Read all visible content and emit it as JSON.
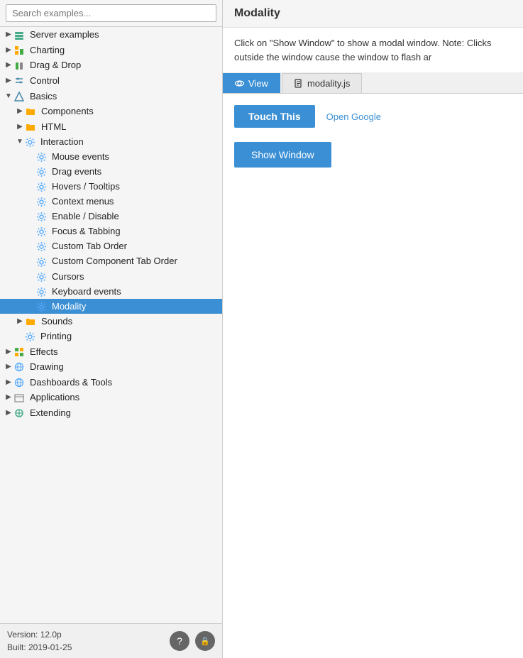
{
  "app": {
    "title": "Modality"
  },
  "search": {
    "placeholder": "Search examples..."
  },
  "tree": {
    "items": [
      {
        "id": "server-examples",
        "label": "Server examples",
        "indent": 0,
        "icon": "📋",
        "icon_class": "icon-server",
        "expandable": true,
        "expanded": false,
        "selected": false
      },
      {
        "id": "charting",
        "label": "Charting",
        "indent": 0,
        "icon": "📊",
        "icon_class": "icon-chart",
        "expandable": true,
        "expanded": false,
        "selected": false
      },
      {
        "id": "drag-drop",
        "label": "Drag & Drop",
        "indent": 0,
        "icon": "📦",
        "icon_class": "icon-drag",
        "expandable": true,
        "expanded": false,
        "selected": false
      },
      {
        "id": "control",
        "label": "Control",
        "indent": 0,
        "icon": "🎛",
        "icon_class": "icon-control",
        "expandable": true,
        "expanded": false,
        "selected": false
      },
      {
        "id": "basics",
        "label": "Basics",
        "indent": 0,
        "icon": "💡",
        "icon_class": "icon-basics",
        "expandable": true,
        "expanded": true,
        "selected": false
      },
      {
        "id": "components",
        "label": "Components",
        "indent": 1,
        "icon": "📁",
        "icon_class": "icon-folder",
        "expandable": true,
        "expanded": false,
        "selected": false
      },
      {
        "id": "html",
        "label": "HTML",
        "indent": 1,
        "icon": "📁",
        "icon_class": "icon-folder",
        "expandable": true,
        "expanded": false,
        "selected": false
      },
      {
        "id": "interaction",
        "label": "Interaction",
        "indent": 1,
        "icon": "⚙",
        "icon_class": "icon-gear",
        "expandable": true,
        "expanded": true,
        "selected": false
      },
      {
        "id": "mouse-events",
        "label": "Mouse events",
        "indent": 2,
        "icon": "⚙",
        "icon_class": "icon-gear",
        "expandable": false,
        "expanded": false,
        "selected": false
      },
      {
        "id": "drag-events",
        "label": "Drag events",
        "indent": 2,
        "icon": "⚙",
        "icon_class": "icon-gear",
        "expandable": false,
        "expanded": false,
        "selected": false
      },
      {
        "id": "hovers-tooltips",
        "label": "Hovers / Tooltips",
        "indent": 2,
        "icon": "⚙",
        "icon_class": "icon-gear",
        "expandable": false,
        "expanded": false,
        "selected": false
      },
      {
        "id": "context-menus",
        "label": "Context menus",
        "indent": 2,
        "icon": "⚙",
        "icon_class": "icon-gear",
        "expandable": false,
        "expanded": false,
        "selected": false
      },
      {
        "id": "enable-disable",
        "label": "Enable / Disable",
        "indent": 2,
        "icon": "⚙",
        "icon_class": "icon-gear",
        "expandable": false,
        "expanded": false,
        "selected": false
      },
      {
        "id": "focus-tabbing",
        "label": "Focus & Tabbing",
        "indent": 2,
        "icon": "⚙",
        "icon_class": "icon-gear",
        "expandable": false,
        "expanded": false,
        "selected": false
      },
      {
        "id": "custom-tab-order",
        "label": "Custom Tab Order",
        "indent": 2,
        "icon": "⚙",
        "icon_class": "icon-gear",
        "expandable": false,
        "expanded": false,
        "selected": false
      },
      {
        "id": "custom-component-tab-order",
        "label": "Custom Component Tab Order",
        "indent": 2,
        "icon": "⚙",
        "icon_class": "icon-gear",
        "expandable": false,
        "expanded": false,
        "selected": false
      },
      {
        "id": "cursors",
        "label": "Cursors",
        "indent": 2,
        "icon": "⚙",
        "icon_class": "icon-gear",
        "expandable": false,
        "expanded": false,
        "selected": false
      },
      {
        "id": "keyboard-events",
        "label": "Keyboard events",
        "indent": 2,
        "icon": "⚙",
        "icon_class": "icon-gear",
        "expandable": false,
        "expanded": false,
        "selected": false
      },
      {
        "id": "modality",
        "label": "Modality",
        "indent": 2,
        "icon": "⚙",
        "icon_class": "icon-gear",
        "expandable": false,
        "expanded": false,
        "selected": true
      },
      {
        "id": "sounds",
        "label": "Sounds",
        "indent": 1,
        "icon": "📁",
        "icon_class": "icon-folder",
        "expandable": true,
        "expanded": false,
        "selected": false
      },
      {
        "id": "printing",
        "label": "Printing",
        "indent": 1,
        "icon": "⚙",
        "icon_class": "icon-gear",
        "expandable": false,
        "expanded": false,
        "selected": false
      },
      {
        "id": "effects",
        "label": "Effects",
        "indent": 0,
        "icon": "📦",
        "icon_class": "icon-effects",
        "expandable": true,
        "expanded": false,
        "selected": false
      },
      {
        "id": "drawing",
        "label": "Drawing",
        "indent": 0,
        "icon": "🌐",
        "icon_class": "icon-drawing",
        "expandable": true,
        "expanded": false,
        "selected": false
      },
      {
        "id": "dashboards-tools",
        "label": "Dashboards & Tools",
        "indent": 0,
        "icon": "🌐",
        "icon_class": "icon-dashboard",
        "expandable": true,
        "expanded": false,
        "selected": false
      },
      {
        "id": "applications",
        "label": "Applications",
        "indent": 0,
        "icon": "📄",
        "icon_class": "icon-apps",
        "expandable": true,
        "expanded": false,
        "selected": false
      },
      {
        "id": "extending",
        "label": "Extending",
        "indent": 0,
        "icon": "🔧",
        "icon_class": "icon-extending",
        "expandable": true,
        "expanded": false,
        "selected": false
      }
    ]
  },
  "version": {
    "line1": "Version: 12.0p",
    "line2": "Built: 2019-01-25"
  },
  "buttons": {
    "help": "?",
    "lock": "🔒"
  },
  "right": {
    "title": "Modality",
    "description": "Click on \"Show Window\" to show a modal window. Note: Clicks outside the window cause the window to flash ar",
    "tabs": [
      {
        "id": "view",
        "label": "View",
        "icon": "🔍",
        "active": true
      },
      {
        "id": "modality-js",
        "label": "modality.js",
        "icon": "📄",
        "active": false
      }
    ],
    "touch_this_label": "Touch This",
    "open_google_label": "Open Google",
    "show_window_label": "Show Window"
  }
}
